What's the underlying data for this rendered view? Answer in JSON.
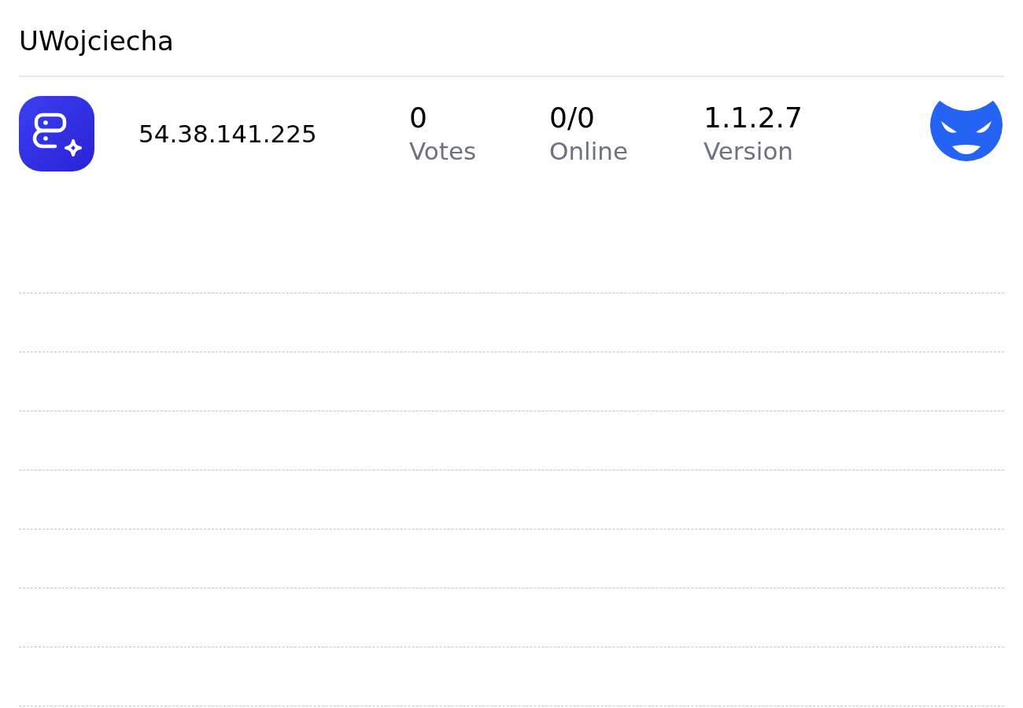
{
  "title": "UWojciecha",
  "server": {
    "address": "54.38.141.225",
    "stats": [
      {
        "value": "0",
        "label": "Votes"
      },
      {
        "value": "0/0",
        "label": "Online"
      },
      {
        "value": "1.1.2.7",
        "label": "Version"
      }
    ]
  }
}
